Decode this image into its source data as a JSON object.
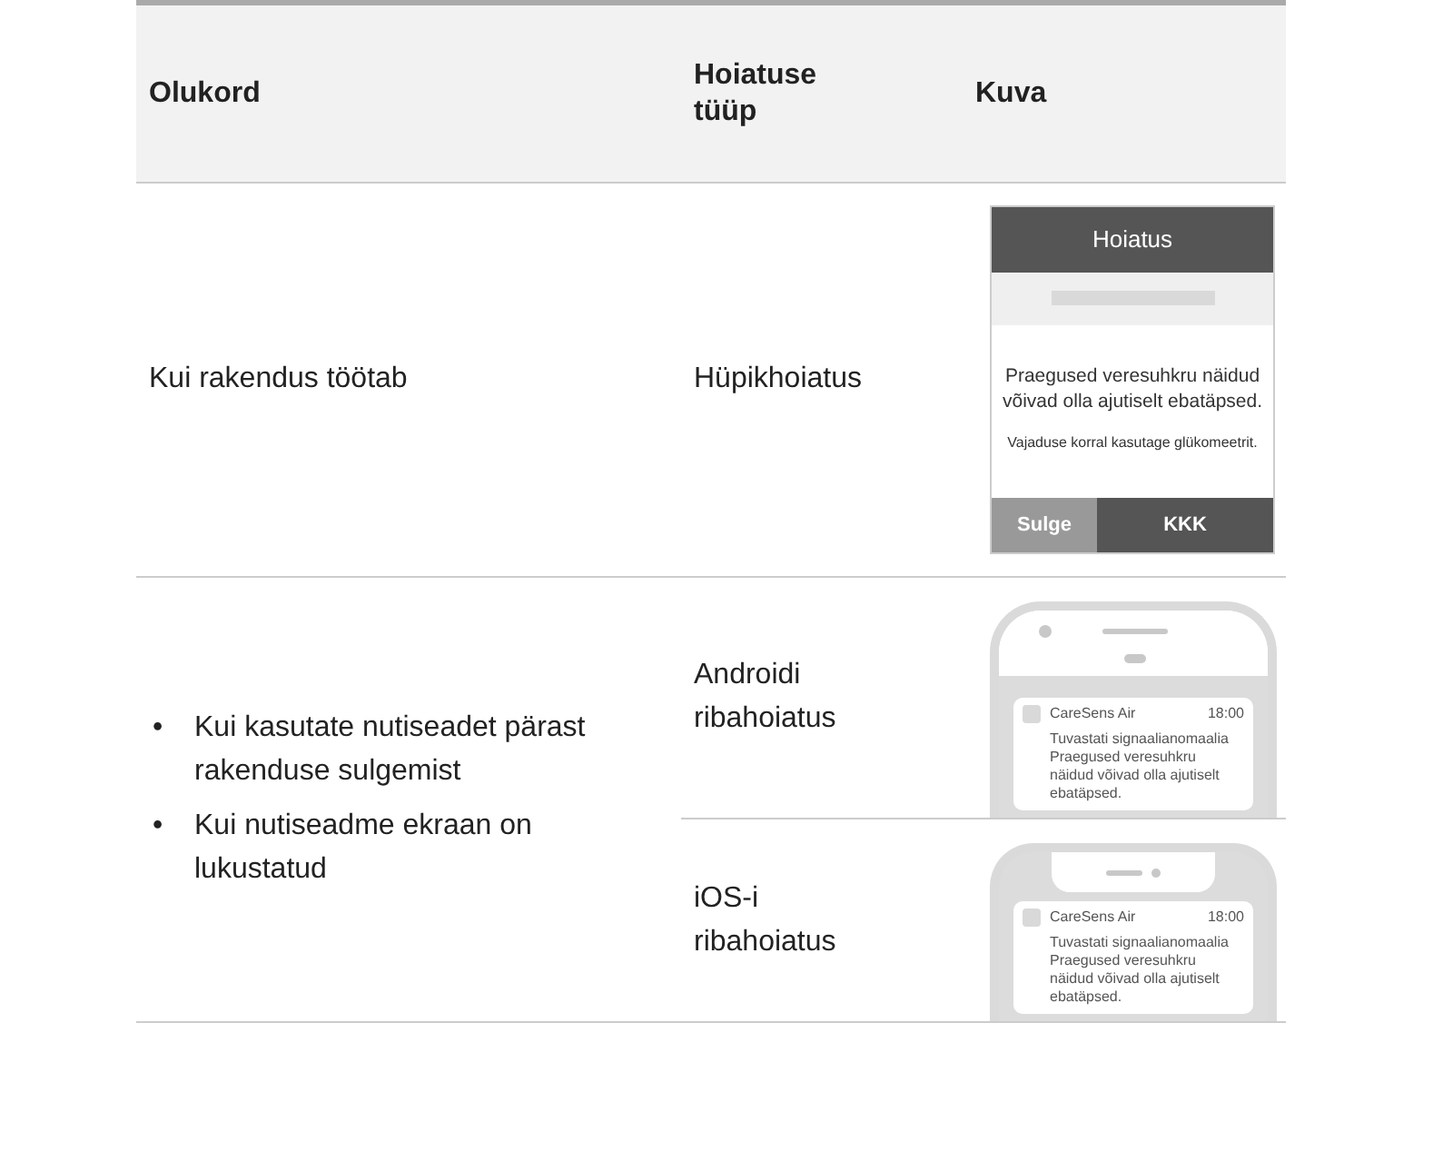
{
  "table": {
    "columns": [
      "Olukord",
      "Hoiatuse tüüp",
      "Kuva"
    ],
    "rows": [
      {
        "situations": [
          "Kui rakendus töötab"
        ],
        "alerts": [
          {
            "type": "Hüpikhoiatus",
            "screen": {
              "kind": "popup",
              "title": "Hoiatus",
              "message": "Praegused veresuhkru näidud võivad olla ajutiselt ebatäpsed.",
              "note": "Vajaduse korral kasutage glükomeetrit.",
              "buttons": [
                {
                  "label": "Sulge",
                  "kind": "secondary"
                },
                {
                  "label": "KKK",
                  "kind": "primary"
                }
              ]
            }
          }
        ]
      },
      {
        "situations": [
          "Kui kasutate nutiseadet pärast rakenduse sulgemist",
          "Kui nutiseadme ekraan on lukustatud"
        ],
        "bullet": "•",
        "alerts": [
          {
            "type": "Androidi ribahoiatus",
            "screen": {
              "kind": "android",
              "app": "CareSens Air",
              "time": "18:00",
              "lines": [
                "Tuvastati signaalianomaalia",
                "Praegused veresuhkru näidud võivad olla ajutiselt ebatäpsed."
              ]
            }
          },
          {
            "type": "iOS-i ribahoiatus",
            "screen": {
              "kind": "ios",
              "app": "CareSens Air",
              "time": "18:00",
              "lines": [
                "Tuvastati signaalianomaalia",
                "Praegused veresuhkru näidud võivad olla ajutiselt ebatäpsed."
              ]
            }
          }
        ]
      }
    ]
  }
}
